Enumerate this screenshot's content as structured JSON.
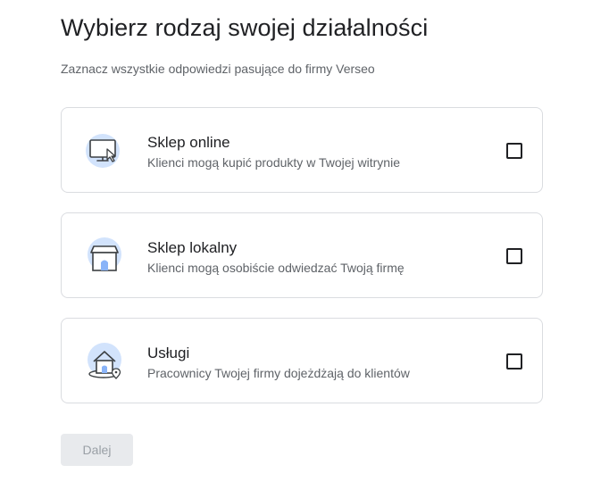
{
  "header": {
    "title": "Wybierz rodzaj swojej działalności",
    "subtitle": "Zaznacz wszystkie odpowiedzi pasujące do firmy Verseo"
  },
  "options": [
    {
      "label": "Sklep online",
      "description": "Klienci mogą kupić produkty w Twojej witrynie",
      "icon": "monitor-cursor-icon",
      "checked": false
    },
    {
      "label": "Sklep lokalny",
      "description": "Klienci mogą osobiście odwiedzać Twoją firmę",
      "icon": "storefront-icon",
      "checked": false
    },
    {
      "label": "Usługi",
      "description": "Pracownicy Twojej firmy dojeżdżają do klientów",
      "icon": "house-location-icon",
      "checked": false
    }
  ],
  "footer": {
    "next_label": "Dalej",
    "next_enabled": false
  },
  "colors": {
    "icon_bg": "#d2e3fc",
    "border": "#dadce0",
    "text_primary": "#202124",
    "text_secondary": "#5f6368",
    "button_disabled_bg": "#e8eaed",
    "button_disabled_text": "#9aa0a6"
  }
}
